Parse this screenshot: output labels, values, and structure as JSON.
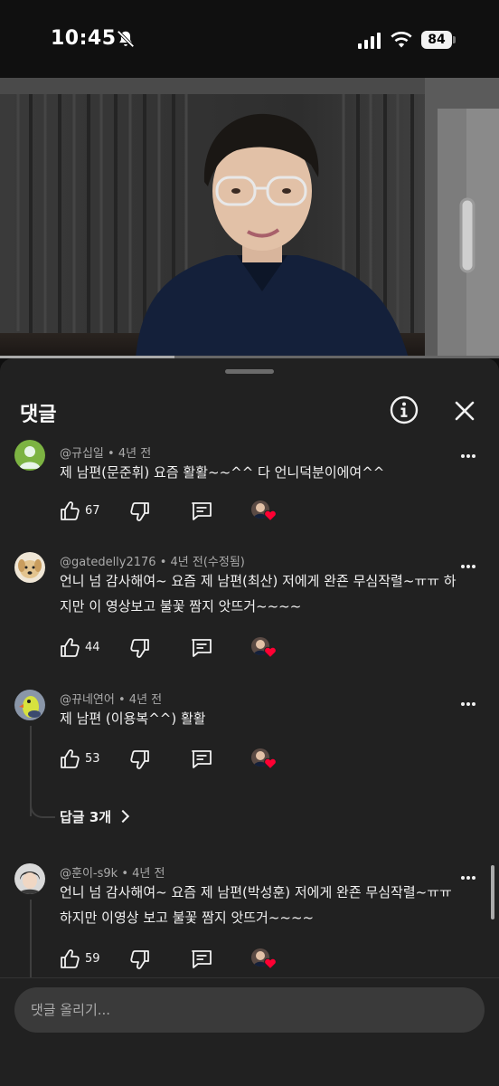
{
  "status_bar": {
    "time": "10:45",
    "battery": "84"
  },
  "panel": {
    "title": "댓글",
    "info_icon": "info-circle-icon",
    "close_icon": "close-icon"
  },
  "comments": [
    {
      "author": "@규십일",
      "time": "4년 전",
      "text": "제 남편(문준휘) 요즘 활활~~^^ 다 언니덕분이에여^^",
      "likes": "67"
    },
    {
      "author": "@gatedelly2176",
      "time": "4년 전(수정됨)",
      "text": "언니 넘 감사해여~ 요즘 제 남편(최산) 저에게 완죤 무심작렬~ㅠㅠ 하지만 이 영상보고 불꽃 짬지 앗뜨거~~~~",
      "likes": "44"
    },
    {
      "author": "@뀨네연어",
      "time": "4년 전",
      "text": "제 남편 (이용복^^) 활활",
      "likes": "53",
      "replies": "답글 3개"
    },
    {
      "author": "@훈이-s9k",
      "time": "4년 전",
      "text": "언니 넘 감사해여~ 요즘 제 남편(박성훈) 저에게 완죤 무심작렬~ㅠㅠ 하지만 이영상 보고 불꽃 짬지 앗뜨거~~~~",
      "likes": "59"
    }
  ],
  "input": {
    "placeholder": "댓글 올리기..."
  },
  "colors": {
    "background": "#0f0f0f",
    "sheet": "#212121",
    "heart": "#ff0033",
    "text": "#f1f1f1",
    "meta": "#aaaaaa"
  }
}
